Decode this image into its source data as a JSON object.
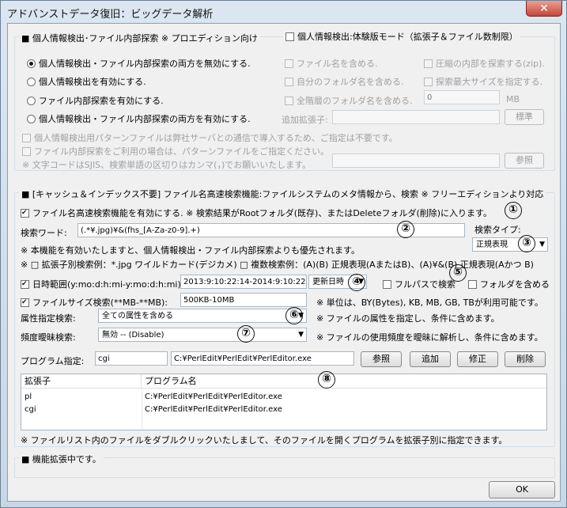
{
  "window": {
    "title": "アドバンストデータ復旧：ビッグデータ解析",
    "close_label": "✕"
  },
  "personal": {
    "group_title": "■ 個人情報検出･ファイル内部探索 ※ プロエディション向け",
    "trial_mode_label": "個人情報検出:体験版モード（拡張子＆ファイル数制限）",
    "radios": [
      "個人情報検出・ファイル内部探索の両方を無効にする.",
      "個人情報検出を有効にする.",
      "ファイル内部探索を有効にする.",
      "個人情報検出・ファイル内部探索の両方を有効にする."
    ],
    "opt_filename": "ファイル名を含める.",
    "opt_own_folder": "自分のフォルダ名を含める.",
    "opt_all_folders": "全階層のフォルダ名を含める.",
    "opt_zip": "圧縮の内部を探索する(zip).",
    "opt_max_size": "探索最大サイズを指定する.",
    "max_size_value": "0",
    "max_size_unit": "MB",
    "add_ext_label": "追加拡張子:",
    "standard_button": "標準",
    "note1": "個人情報検出用パターンファイルは弊社サーバとの通信で導入するため、ご指定は不要です。",
    "note2": "ファイル内部探索をご利用の場合は、パターンファイルをご指定ください。",
    "note3": "※ 文字コードはSJIS、検索単語の区切りはカンマ(，)でお願いいたします。",
    "browse_button": "参照"
  },
  "fast_search": {
    "group_title": "■ [キャッシュ＆インデックス不要] ファイル名高速検索機能:ファイルシステムのメタ情報から、検索 ※ フリーエディションより対応",
    "enable_label": "ファイル名高速検索機能を有効にする. ※ 検索結果がRootフォルダ(既存)、またはDeleteフォルダ(削除)に入ります。",
    "keyword_label": "検索ワード:",
    "keyword_value": "(.*¥.jpg)¥&(fhs_[A-Za-z0-9].+)",
    "search_type_label": "検索タイプ:",
    "search_type_value": "正規表現",
    "priority_note": "※ 本機能を有効いたしますと、個人情報検出・ファイル内部探索よりも優先されます。",
    "example_note": "※ □ 拡張子別検索例：*.jpg ワイルドカード(デジカメ) □ 複数検索例：(A)(B) 正規表現(AまたはB)、(A)¥&(B) 正規表現(Aかつ B)",
    "date_label": "日時範囲(y:mo:d:h:mi-y:mo:d:h:mi):",
    "date_value": "2013:9:10:22:14-2014:9:10:22:14",
    "date_type_value": "更新日時",
    "full_path_label": "フルパスで検索",
    "include_folder_label": "フォルダを含める",
    "size_label": "ファイルサイズ検索(**MB-**MB):",
    "size_value": "500KB-10MB",
    "size_note": "※ 単位は、BY(Bytes), KB, MB, GB, TBが利用可能です。",
    "attr_label": "属性指定検索:",
    "attr_value": "全ての属性を含める",
    "attr_note": "※ ファイルの属性を指定し、条件に含めます。",
    "freq_label": "頻度曖昧検索:",
    "freq_value": "無効 -- (Disable)",
    "freq_note": "※ ファイルの使用頻度を曖昧に解析し、条件に含めます。"
  },
  "program": {
    "label": "プログラム指定:",
    "ext_value": "cgi",
    "path_value": "C:¥PerlEdit¥PerlEdit¥PerlEditor.exe",
    "browse_button": "参照",
    "add_button": "追加",
    "edit_button": "修正",
    "delete_button": "削除",
    "columns": [
      "拡張子",
      "プログラム名"
    ],
    "rows": [
      {
        "ext": "pl",
        "program": "C:¥PerlEdit¥PerlEdit¥PerlEditor.exe"
      },
      {
        "ext": "cgi",
        "program": "C:¥PerlEdit¥PerlEdit¥PerlEditor.exe"
      }
    ],
    "note": "※ ファイルリスト内のファイルをダブルクリックいたしまして、そのファイルを開くプログラムを拡張子別に指定できます。"
  },
  "extension": {
    "label": "■ 機能拡張中です。"
  },
  "footer": {
    "ok_button": "OK"
  },
  "markers": [
    "①",
    "②",
    "③",
    "④",
    "⑤",
    "⑥",
    "⑦",
    "⑧"
  ]
}
